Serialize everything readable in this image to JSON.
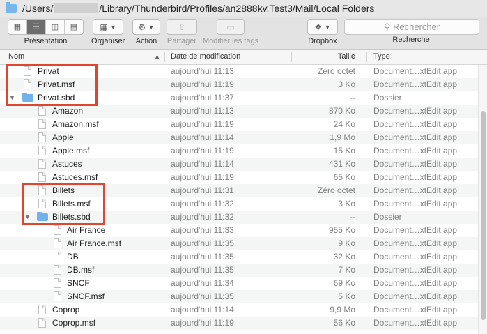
{
  "window": {
    "path_prefix": "/Users/",
    "path_suffix": "/Library/Thunderbird/Profiles/an2888kv.Test3/Mail/Local Folders"
  },
  "toolbar": {
    "presentation_label": "Présentation",
    "organiser_label": "Organiser",
    "action_label": "Action",
    "partager_label": "Partager",
    "modifier_label": "Modifier les tags",
    "dropbox_label": "Dropbox",
    "recherche_label": "Recherche",
    "search_placeholder": "Rechercher"
  },
  "columns": {
    "name": "Nom",
    "date": "Date de modification",
    "size": "Taille",
    "kind": "Type"
  },
  "rows": [
    {
      "name": "Privat",
      "date": "aujourd'hui 11:13",
      "size": "Zéro octet",
      "kind": "Document…xtEdit.app"
    },
    {
      "name": "Privat.msf",
      "date": "aujourd'hui 11:19",
      "size": "3 Ko",
      "kind": "Document…xtEdit.app"
    },
    {
      "name": "Privat.sbd",
      "date": "aujourd'hui 11:37",
      "size": "--",
      "kind": "Dossier"
    },
    {
      "name": "Amazon",
      "date": "aujourd'hui 11:13",
      "size": "870 Ko",
      "kind": "Document…xtEdit.app"
    },
    {
      "name": "Amazon.msf",
      "date": "aujourd'hui 11:19",
      "size": "24 Ko",
      "kind": "Document…xtEdit.app"
    },
    {
      "name": "Apple",
      "date": "aujourd'hui 11:14",
      "size": "1,9 Mo",
      "kind": "Document…xtEdit.app"
    },
    {
      "name": "Apple.msf",
      "date": "aujourd'hui 11:19",
      "size": "15 Ko",
      "kind": "Document…xtEdit.app"
    },
    {
      "name": "Astuces",
      "date": "aujourd'hui 11:14",
      "size": "431 Ko",
      "kind": "Document…xtEdit.app"
    },
    {
      "name": "Astuces.msf",
      "date": "aujourd'hui 11:19",
      "size": "65 Ko",
      "kind": "Document…xtEdit.app"
    },
    {
      "name": "Billets",
      "date": "aujourd'hui 11:31",
      "size": "Zéro octet",
      "kind": "Document…xtEdit.app"
    },
    {
      "name": "Billets.msf",
      "date": "aujourd'hui 11:32",
      "size": "3 Ko",
      "kind": "Document…xtEdit.app"
    },
    {
      "name": "Billets.sbd",
      "date": "aujourd'hui 11:32",
      "size": "--",
      "kind": "Dossier"
    },
    {
      "name": "Air France",
      "date": "aujourd'hui 11:33",
      "size": "955 Ko",
      "kind": "Document…xtEdit.app"
    },
    {
      "name": "Air France.msf",
      "date": "aujourd'hui 11:35",
      "size": "9 Ko",
      "kind": "Document…xtEdit.app"
    },
    {
      "name": "DB",
      "date": "aujourd'hui 11:35",
      "size": "32 Ko",
      "kind": "Document…xtEdit.app"
    },
    {
      "name": "DB.msf",
      "date": "aujourd'hui 11:35",
      "size": "7 Ko",
      "kind": "Document…xtEdit.app"
    },
    {
      "name": "SNCF",
      "date": "aujourd'hui 11:34",
      "size": "69 Ko",
      "kind": "Document…xtEdit.app"
    },
    {
      "name": "SNCF.msf",
      "date": "aujourd'hui 11:35",
      "size": "5 Ko",
      "kind": "Document…xtEdit.app"
    },
    {
      "name": "Coprop",
      "date": "aujourd'hui 11:14",
      "size": "9,9 Mo",
      "kind": "Document…xtEdit.app"
    },
    {
      "name": "Coprop.msf",
      "date": "aujourd'hui 11:19",
      "size": "56 Ko",
      "kind": "Document…xtEdit.app"
    }
  ],
  "colors": {
    "highlight_box": "#e0452f",
    "folder_blue": "#72b2ec"
  }
}
